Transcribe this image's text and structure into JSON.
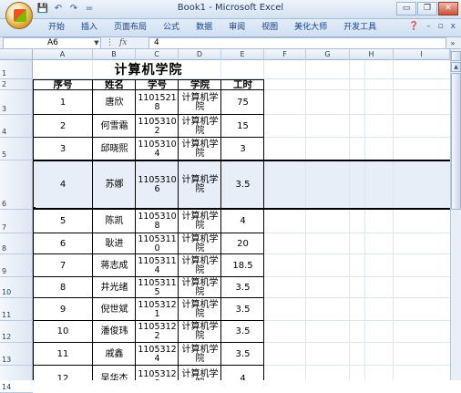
{
  "window": {
    "title": "Book1 - Microsoft Excel",
    "minimize": "▭",
    "restore": "❐",
    "close": "✕"
  },
  "qat": {
    "save": "💾",
    "undo": "↶",
    "redo": "↷",
    "more": "="
  },
  "ribbon": {
    "tabs": [
      "开始",
      "插入",
      "页面布局",
      "公式",
      "数据",
      "审阅",
      "视图",
      "美化大师",
      "开发工具"
    ],
    "help": "❓",
    "min": "–",
    "restore": "▫",
    "close": "x"
  },
  "formula_bar": {
    "name_box": "A6",
    "fx": "fx",
    "formula": "4",
    "expand": "»"
  },
  "columns": [
    "A",
    "B",
    "C",
    "D",
    "E",
    "F",
    "G",
    "H",
    "I"
  ],
  "rows": [
    "1",
    "2",
    "3",
    "4",
    "5",
    "6",
    "7",
    "8",
    "9",
    "10",
    "11",
    "12",
    "13",
    "14"
  ],
  "sheet": {
    "title": "计算机学院",
    "headers": [
      "序号",
      "姓名",
      "学号",
      "学院",
      "工时"
    ],
    "records": [
      [
        "1",
        "唐欣",
        "11015218",
        "计算机学院",
        "75"
      ],
      [
        "2",
        "何雪霜",
        "11053102",
        "计算机学院",
        "15"
      ],
      [
        "3",
        "邱晓熙",
        "11053104",
        "计算机学院",
        "3"
      ],
      [
        "4",
        "苏娜",
        "11053106",
        "计算机学院",
        "3.5"
      ],
      [
        "5",
        "陈凯",
        "11053108",
        "计算机学院",
        "4"
      ],
      [
        "6",
        "耿进",
        "11053110",
        "计算机学院",
        "20"
      ],
      [
        "7",
        "蒋志成",
        "11053114",
        "计算机学院",
        "18.5"
      ],
      [
        "8",
        "井光绪",
        "11053115",
        "计算机学院",
        "3.5"
      ],
      [
        "9",
        "倪世斌",
        "11053121",
        "计算机学院",
        "3.5"
      ],
      [
        "10",
        "潘俊玮",
        "11053122",
        "计算机学院",
        "3.5"
      ],
      [
        "11",
        "戚鑫",
        "11053124",
        "计算机学院",
        "3.5"
      ],
      [
        "12",
        "吴华杰",
        "11053128",
        "计算机学院",
        "4"
      ]
    ]
  }
}
